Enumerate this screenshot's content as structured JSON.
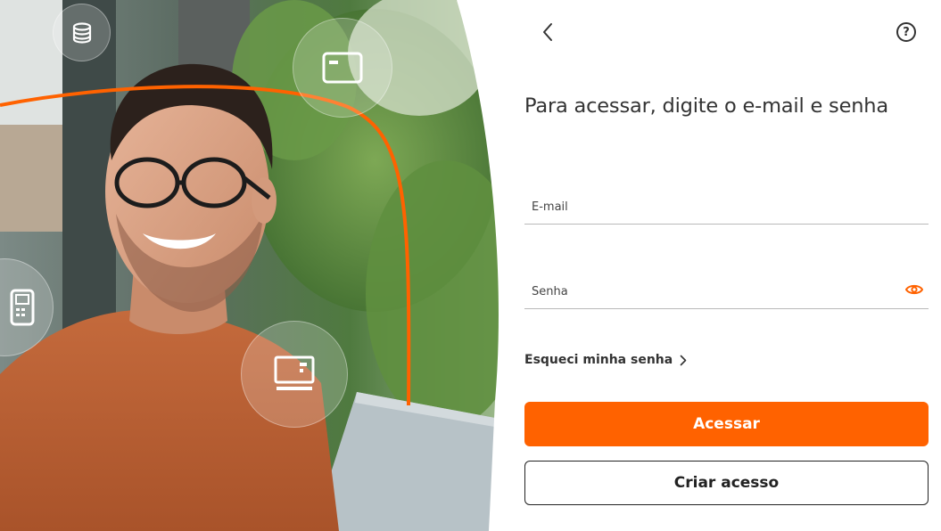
{
  "hero": {
    "accent_color": "#ff6200",
    "bubbles": [
      "coins-icon",
      "credit-card-icon",
      "pos-machine-icon",
      "card-terminal-icon"
    ]
  },
  "header": {
    "back_icon": "chevron-left-icon",
    "help_icon": "help-circle-icon",
    "help_glyph": "?"
  },
  "login": {
    "title": "Para acessar, digite o e-mail e senha",
    "email_placeholder": "E-mail",
    "password_placeholder": "Senha",
    "show_password_icon": "eye-icon",
    "forgot_label": "Esqueci minha senha",
    "submit_label": "Acessar",
    "create_label": "Criar acesso"
  },
  "colors": {
    "primary": "#ff6200",
    "text": "#333333",
    "border": "#222222"
  }
}
